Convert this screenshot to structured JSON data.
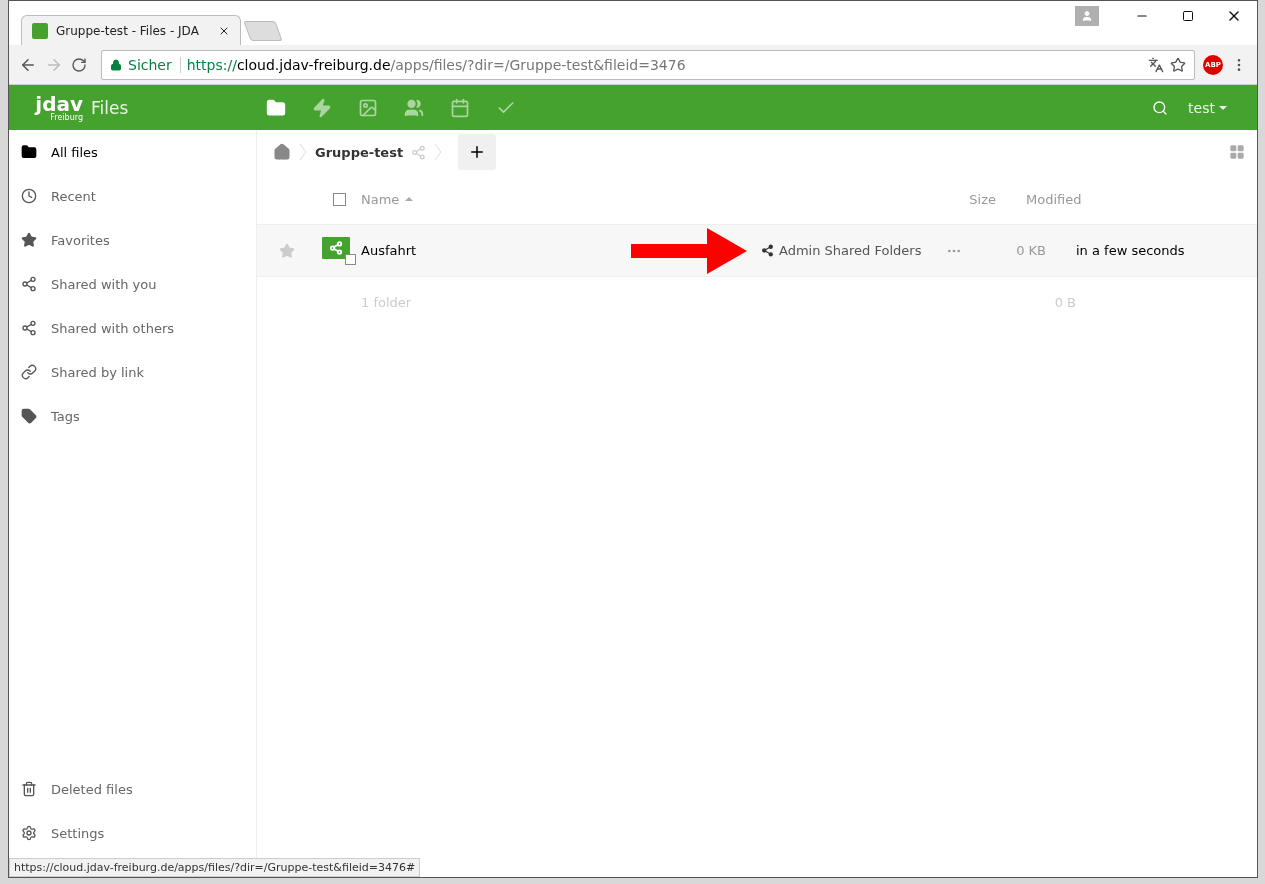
{
  "browser": {
    "tabs": [
      {
        "title": "Gruppe-test - Files - JDA",
        "selected": true
      }
    ],
    "security_label": "Sicher",
    "url": {
      "scheme": "https://",
      "host": "cloud.jdav-freiburg.de",
      "path": "/apps/files/?dir=/Gruppe-test&fileid=3476"
    },
    "extension_badge": "ABP"
  },
  "app": {
    "logo": "jdav",
    "logo_sub": "Freiburg",
    "title": "Files",
    "nav": [
      {
        "kind": "files",
        "selected": true
      },
      {
        "kind": "activity",
        "selected": false
      },
      {
        "kind": "gallery",
        "selected": false
      },
      {
        "kind": "contacts",
        "selected": false
      },
      {
        "kind": "calendar",
        "selected": false
      },
      {
        "kind": "tasks",
        "selected": false
      }
    ],
    "user": "test"
  },
  "sidebar": {
    "items": [
      {
        "kind": "folder",
        "label": "All files",
        "selected": true
      },
      {
        "kind": "recent",
        "label": "Recent",
        "selected": false
      },
      {
        "kind": "star",
        "label": "Favorites",
        "selected": false
      },
      {
        "kind": "share",
        "label": "Shared with you",
        "selected": false
      },
      {
        "kind": "share",
        "label": "Shared with others",
        "selected": false
      },
      {
        "kind": "link",
        "label": "Shared by link",
        "selected": false
      },
      {
        "kind": "tag",
        "label": "Tags",
        "selected": false
      }
    ],
    "footer": [
      {
        "kind": "trash",
        "label": "Deleted files"
      },
      {
        "kind": "settings",
        "label": "Settings"
      }
    ]
  },
  "breadcrumb": {
    "folder": "Gruppe-test"
  },
  "table": {
    "select_all_checked": false,
    "columns": [
      "Name",
      "Size",
      "Modified"
    ],
    "rows": [
      {
        "name": "Ausfahrt",
        "favorite": false,
        "share": "Admin Shared Folders",
        "size": "0 KB",
        "modified": "in a few seconds"
      }
    ],
    "summary": {
      "count": "1 folder",
      "size": "0 B"
    }
  },
  "status_url": "https://cloud.jdav-freiburg.de/apps/files/?dir=/Gruppe-test&fileid=3476#"
}
